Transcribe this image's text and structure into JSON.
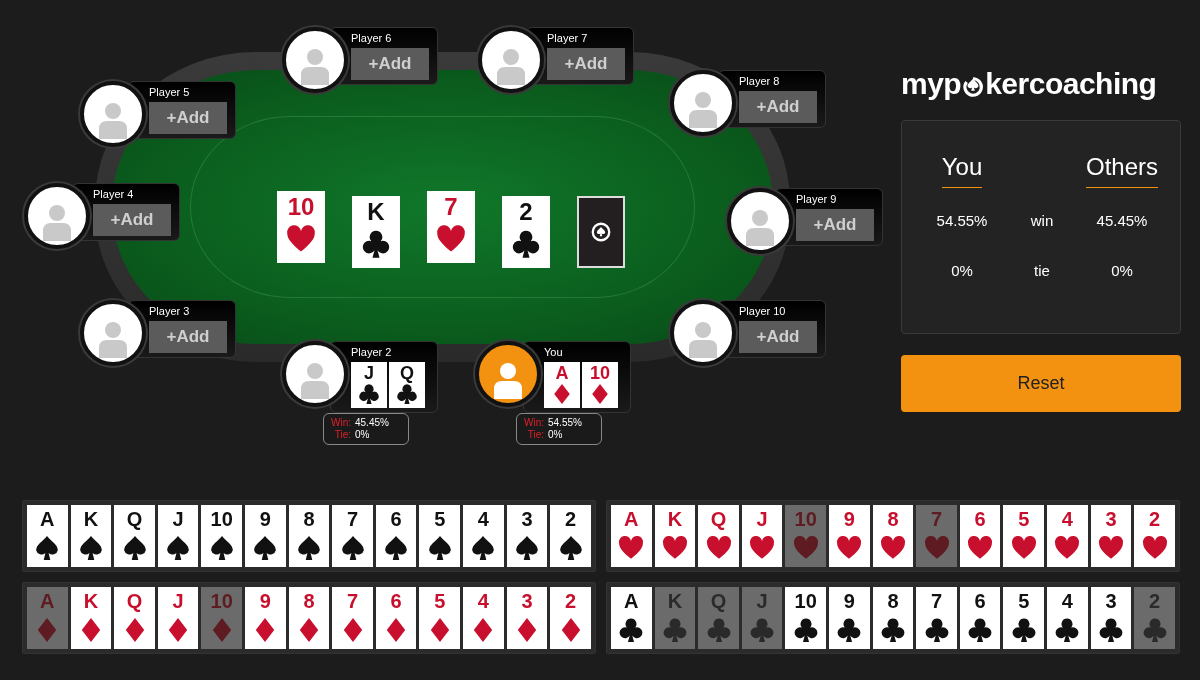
{
  "seats": [
    {
      "name": "Player 6",
      "active": false,
      "kind": "empty",
      "add": "+Add"
    },
    {
      "name": "Player 7",
      "active": false,
      "kind": "empty",
      "add": "+Add"
    },
    {
      "name": "Player 5",
      "active": false,
      "kind": "empty",
      "add": "+Add"
    },
    {
      "name": "Player 8",
      "active": false,
      "kind": "empty",
      "add": "+Add"
    },
    {
      "name": "Player 4",
      "active": false,
      "kind": "empty",
      "add": "+Add"
    },
    {
      "name": "Player 9",
      "active": false,
      "kind": "empty",
      "add": "+Add"
    },
    {
      "name": "Player 3",
      "active": false,
      "kind": "empty",
      "add": "+Add"
    },
    {
      "name": "Player 10",
      "active": false,
      "kind": "empty",
      "add": "+Add"
    },
    {
      "name": "Player 2",
      "active": false,
      "kind": "hand",
      "cards": [
        {
          "rank": "J",
          "kind": "clubs"
        },
        {
          "rank": "Q",
          "kind": "clubs"
        }
      ],
      "stats": [
        {
          "label": "Win:",
          "value": "45.45%"
        },
        {
          "label": "Tie:",
          "value": "0%"
        }
      ]
    },
    {
      "name": "You",
      "active": true,
      "kind": "hand",
      "cards": [
        {
          "rank": "A",
          "kind": "diamonds"
        },
        {
          "rank": "10",
          "kind": "diamonds"
        }
      ],
      "stats": [
        {
          "label": "Win:",
          "value": "54.55%"
        },
        {
          "label": "Tie:",
          "value": "0%"
        }
      ]
    }
  ],
  "board": [
    {
      "kind": "hearts",
      "rank": "10"
    },
    {
      "kind": "clubs",
      "rank": "K"
    },
    {
      "kind": "hearts",
      "rank": "7"
    },
    {
      "kind": "clubs",
      "rank": "2"
    },
    {
      "kind": "back"
    }
  ],
  "logo": {
    "before": "myp",
    "after": "kercoaching"
  },
  "odds": {
    "headers": [
      "You",
      "Others"
    ],
    "rows": [
      {
        "you": "54.55%",
        "label": "win",
        "others": "45.45%"
      },
      {
        "you": "0%",
        "label": "tie",
        "others": "0%"
      }
    ]
  },
  "reset_button": "Reset",
  "deck": [
    {
      "kind": "spades",
      "cards": [
        {
          "rank": "A",
          "used": false
        },
        {
          "rank": "K",
          "used": false
        },
        {
          "rank": "Q",
          "used": false
        },
        {
          "rank": "J",
          "used": false
        },
        {
          "rank": "10",
          "used": false
        },
        {
          "rank": "9",
          "used": false
        },
        {
          "rank": "8",
          "used": false
        },
        {
          "rank": "7",
          "used": false
        },
        {
          "rank": "6",
          "used": false
        },
        {
          "rank": "5",
          "used": false
        },
        {
          "rank": "4",
          "used": false
        },
        {
          "rank": "3",
          "used": false
        },
        {
          "rank": "2",
          "used": false
        }
      ]
    },
    {
      "kind": "hearts",
      "cards": [
        {
          "rank": "A",
          "used": false
        },
        {
          "rank": "K",
          "used": false
        },
        {
          "rank": "Q",
          "used": false
        },
        {
          "rank": "J",
          "used": false
        },
        {
          "rank": "10",
          "used": true
        },
        {
          "rank": "9",
          "used": false
        },
        {
          "rank": "8",
          "used": false
        },
        {
          "rank": "7",
          "used": true
        },
        {
          "rank": "6",
          "used": false
        },
        {
          "rank": "5",
          "used": false
        },
        {
          "rank": "4",
          "used": false
        },
        {
          "rank": "3",
          "used": false
        },
        {
          "rank": "2",
          "used": false
        }
      ]
    },
    {
      "kind": "diamonds",
      "cards": [
        {
          "rank": "A",
          "used": true
        },
        {
          "rank": "K",
          "used": false
        },
        {
          "rank": "Q",
          "used": false
        },
        {
          "rank": "J",
          "used": false
        },
        {
          "rank": "10",
          "used": true
        },
        {
          "rank": "9",
          "used": false
        },
        {
          "rank": "8",
          "used": false
        },
        {
          "rank": "7",
          "used": false
        },
        {
          "rank": "6",
          "used": false
        },
        {
          "rank": "5",
          "used": false
        },
        {
          "rank": "4",
          "used": false
        },
        {
          "rank": "3",
          "used": false
        },
        {
          "rank": "2",
          "used": false
        }
      ]
    },
    {
      "kind": "clubs",
      "cards": [
        {
          "rank": "A",
          "used": false
        },
        {
          "rank": "K",
          "used": true
        },
        {
          "rank": "Q",
          "used": true
        },
        {
          "rank": "J",
          "used": true
        },
        {
          "rank": "10",
          "used": false
        },
        {
          "rank": "9",
          "used": false
        },
        {
          "rank": "8",
          "used": false
        },
        {
          "rank": "7",
          "used": false
        },
        {
          "rank": "6",
          "used": false
        },
        {
          "rank": "5",
          "used": false
        },
        {
          "rank": "4",
          "used": false
        },
        {
          "rank": "3",
          "used": false
        },
        {
          "rank": "2",
          "used": true
        }
      ]
    }
  ]
}
